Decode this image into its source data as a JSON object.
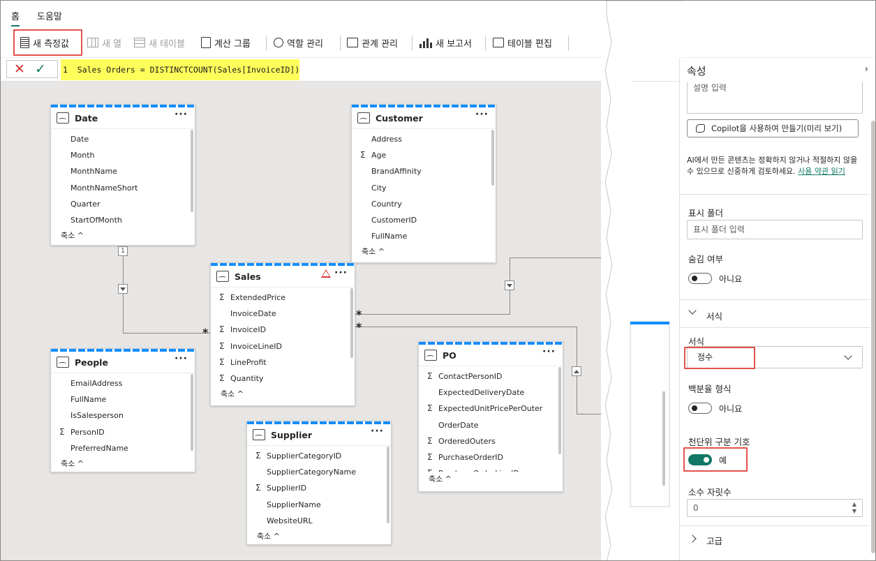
{
  "menu": {
    "home": "홈",
    "help": "도움말"
  },
  "toolbar": {
    "new_measure": "새 측정값",
    "new_column": "새 열",
    "new_table": "새 테이블",
    "calc_group": "계산 그룹",
    "manage_roles": "역할 관리",
    "manage_relationships": "관계 관리",
    "new_report": "새 보고서",
    "edit_tables": "테이블 편집"
  },
  "formula": {
    "text": "1  Sales Orders = DISTINCTCOUNT(Sales[InvoiceID])"
  },
  "tables": {
    "date": {
      "title": "Date",
      "rows": [
        {
          "name": "Date",
          "sum": ""
        },
        {
          "name": "Month",
          "sum": ""
        },
        {
          "name": "MonthName",
          "sum": ""
        },
        {
          "name": "MonthNameShort",
          "sum": ""
        },
        {
          "name": "Quarter",
          "sum": ""
        },
        {
          "name": "StartOfMonth",
          "sum": ""
        }
      ],
      "collapse": "축소 ^"
    },
    "customer": {
      "title": "Customer",
      "rows": [
        {
          "name": "Address",
          "sum": ""
        },
        {
          "name": "Age",
          "sum": "Σ"
        },
        {
          "name": "BrandAffinity",
          "sum": ""
        },
        {
          "name": "City",
          "sum": ""
        },
        {
          "name": "Country",
          "sum": ""
        },
        {
          "name": "CustomerID",
          "sum": ""
        },
        {
          "name": "FullName",
          "sum": ""
        }
      ],
      "collapse": "축소 ^"
    },
    "sales": {
      "title": "Sales",
      "rows": [
        {
          "name": "ExtendedPrice",
          "sum": "Σ"
        },
        {
          "name": "InvoiceDate",
          "sum": ""
        },
        {
          "name": "InvoiceID",
          "sum": "Σ"
        },
        {
          "name": "InvoiceLineID",
          "sum": "Σ"
        },
        {
          "name": "LineProfit",
          "sum": "Σ"
        },
        {
          "name": "Quantity",
          "sum": "Σ"
        }
      ],
      "collapse": "축소 ^"
    },
    "people": {
      "title": "People",
      "rows": [
        {
          "name": "EmailAddress",
          "sum": ""
        },
        {
          "name": "FullName",
          "sum": ""
        },
        {
          "name": "IsSalesperson",
          "sum": ""
        },
        {
          "name": "PersonID",
          "sum": "Σ"
        },
        {
          "name": "PreferredName",
          "sum": ""
        }
      ],
      "collapse": "축소 ^"
    },
    "po": {
      "title": "PO",
      "rows": [
        {
          "name": "ContactPersonID",
          "sum": "Σ"
        },
        {
          "name": "ExpectedDeliveryDate",
          "sum": ""
        },
        {
          "name": "ExpectedUnitPricePerOuter",
          "sum": "Σ"
        },
        {
          "name": "OrderDate",
          "sum": ""
        },
        {
          "name": "OrderedOuters",
          "sum": "Σ"
        },
        {
          "name": "PurchaseOrderID",
          "sum": "Σ"
        },
        {
          "name": "PurchaseOrderLineID",
          "sum": "Σ"
        }
      ],
      "collapse": "축소 ^"
    },
    "supplier": {
      "title": "Supplier",
      "rows": [
        {
          "name": "SupplierCategoryID",
          "sum": "Σ"
        },
        {
          "name": "SupplierCategoryName",
          "sum": ""
        },
        {
          "name": "SupplierID",
          "sum": "Σ"
        },
        {
          "name": "SupplierName",
          "sum": ""
        },
        {
          "name": "WebsiteURL",
          "sum": ""
        }
      ],
      "collapse": "축소 ^"
    }
  },
  "relationship": {
    "one": "1",
    "many": "*"
  },
  "properties": {
    "title": "속성",
    "desc_placeholder": "설명 입력",
    "copilot_button": "Copilot을 사용하여 만들기(미리 보기)",
    "ai_notice": "AI에서 만든 콘텐츠는 정확하지 않거나 적절하지 않을 수 있으므로 신중하게 검토하세요.",
    "terms_link": "사용 약관 읽기",
    "display_folder_label": "표시 폴더",
    "display_folder_placeholder": "표시 폴더 입력",
    "hidden_label": "숨김 여부",
    "hidden_value": "아니요",
    "format_section": "서식",
    "format_label": "서식",
    "format_value": "정수",
    "percent_label": "백분율 형식",
    "percent_value": "아니요",
    "thousands_label": "천단위 구분 기호",
    "thousands_value": "예",
    "decimals_label": "소수 자릿수",
    "decimals_value": "0",
    "advanced_section": "고급"
  },
  "colors": {
    "accent": "#117865",
    "highlight": "#e3514d",
    "formula_bg": "#ffff5c"
  }
}
